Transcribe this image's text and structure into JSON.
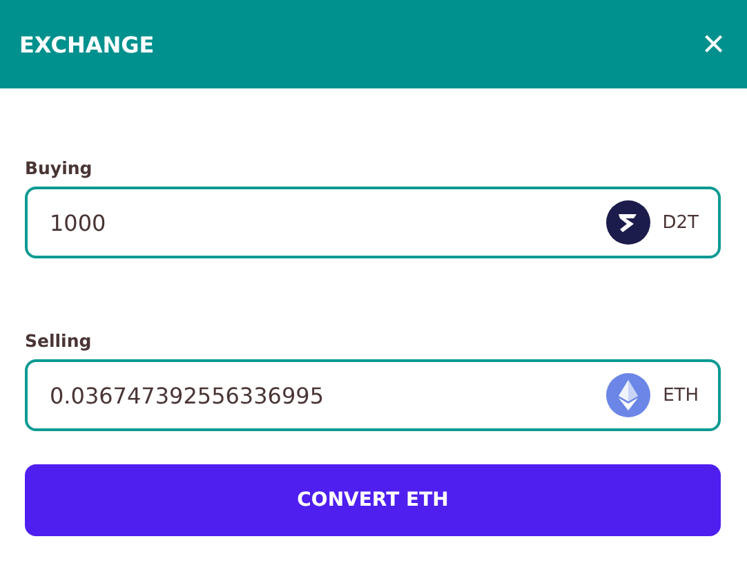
{
  "header": {
    "title": "EXCHANGE",
    "close": "×"
  },
  "fields": [
    {
      "label": "Buying",
      "value": "1000",
      "token": {
        "kind": "d2t",
        "symbol": "D2T"
      }
    },
    {
      "label": "Selling",
      "value": "0.036747392556336995",
      "token": {
        "kind": "eth",
        "symbol": "ETH"
      }
    }
  ],
  "button": {
    "label": "CONVERT ETH"
  }
}
